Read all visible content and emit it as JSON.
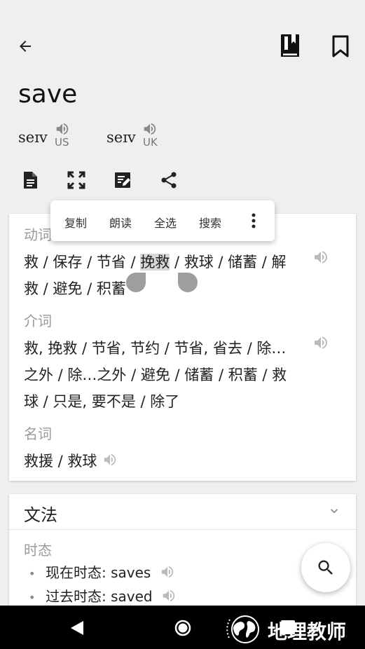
{
  "entry": {
    "word": "save",
    "pronunciations": [
      {
        "phonetic": "seɪv",
        "region": "US"
      },
      {
        "phonetic": "seɪv",
        "region": "UK"
      }
    ]
  },
  "toolbar_icons": [
    "back-arrow-icon",
    "book-icon",
    "bookmark-icon",
    "document-icon",
    "fullscreen-icon",
    "note-edit-icon",
    "share-icon"
  ],
  "selection_menu": {
    "copy": "复制",
    "read": "朗读",
    "select_all": "全选",
    "search": "搜索"
  },
  "definitions": {
    "verb": {
      "label": "动词",
      "line1_pre": "救 / 保存 / 节省 / ",
      "line1_sel": "挽救",
      "line1_post": " / 救球 / 储蓄 / 解",
      "line2": "救 / 避免 / 积蓄"
    },
    "preposition": {
      "label": "介词",
      "line1": "救, 挽救 / 节省, 节约 / 节省, 省去 / 除…",
      "line2": "之外 / 除…之外 / 避免 / 储蓄 / 积蓄 / 救",
      "line3": "球 / 只是, 要不是 / 除了"
    },
    "noun": {
      "label": "名词",
      "line1": "救援 / 救球"
    }
  },
  "grammar": {
    "title": "文法",
    "section": "时态",
    "tenses": [
      {
        "label": "现在时态:",
        "value": "saves"
      },
      {
        "label": "过去时态:",
        "value": "saved"
      }
    ]
  },
  "watermark": {
    "text": "地理教师"
  },
  "colors": {
    "background": "#efefef",
    "card": "#ffffff",
    "muted_text": "#9a9a9a",
    "selection_highlight": "#d8d8d8",
    "handle": "#9e9e9e",
    "navbar": "#000000"
  }
}
